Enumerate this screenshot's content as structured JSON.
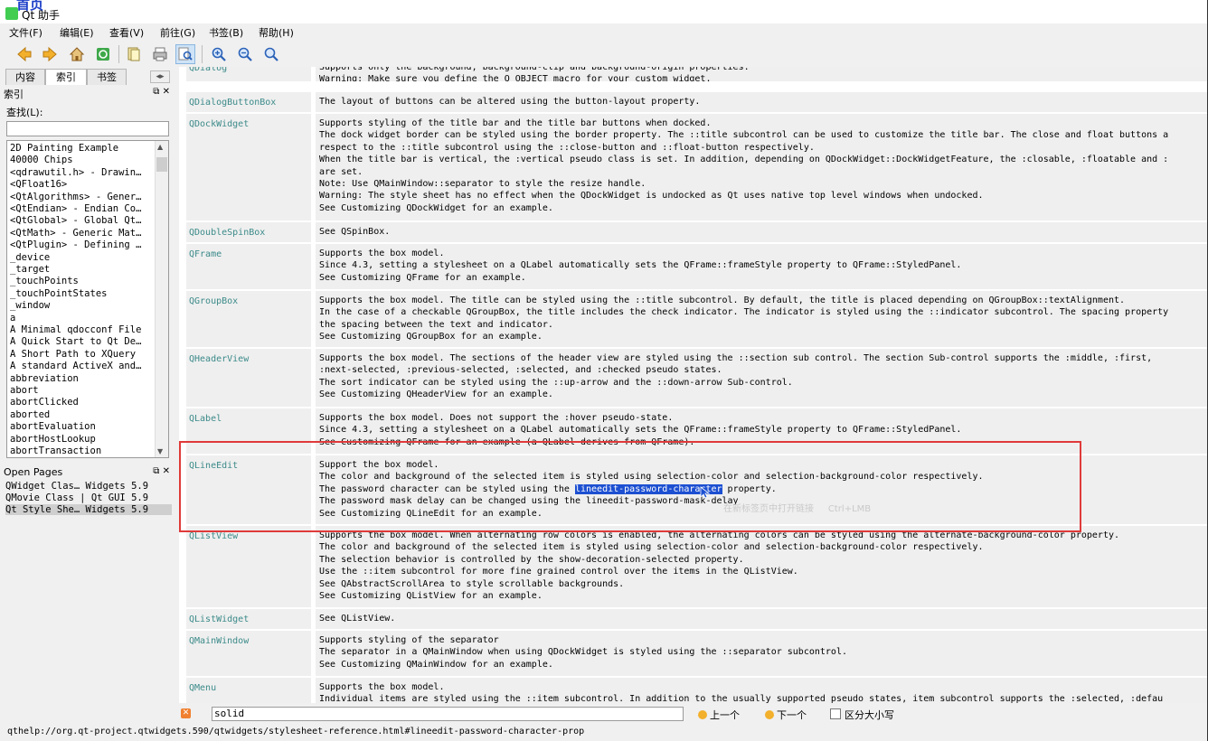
{
  "window": {
    "title": "Qt 助手",
    "overlay_text": "首页"
  },
  "menu": [
    "文件(F)",
    "编辑(E)",
    "查看(V)",
    "前往(G)",
    "书签(B)",
    "帮助(H)"
  ],
  "toolbar": [
    "back-icon",
    "forward-icon",
    "home-icon",
    "sync-icon",
    "copy-icon",
    "print-icon",
    "find-icon",
    "zoom-in-icon",
    "zoom-out-icon",
    "zoom-reset-icon"
  ],
  "sidebar": {
    "tabs": [
      "内容",
      "索引",
      "书签"
    ],
    "index_title": "索引",
    "find_label": "查找(L):",
    "find_value": "",
    "index_items": [
      "2D Painting Example",
      "40000 Chips",
      "<qdrawutil.h> - Drawin…",
      "<QFloat16>",
      "<QtAlgorithms> - Gener…",
      "<QtEndian> - Endian Co…",
      "<QtGlobal> - Global Qt…",
      "<QtMath> - Generic Mat…",
      "<QtPlugin> - Defining …",
      "_device",
      "_target",
      "_touchPoints",
      "_touchPointStates",
      "_window",
      "a",
      "A Minimal qdocconf File",
      "A Quick Start to Qt De…",
      "A Short Path to XQuery",
      "A standard ActiveX and…",
      "abbreviation",
      "abort",
      "abortClicked",
      "aborted",
      "abortEvaluation",
      "abortHostLookup",
      "abortTransaction"
    ],
    "open_pages_title": "Open Pages",
    "open_pages": [
      "QWidget Clas… Widgets 5.9",
      "QMovie Class | Qt GUI 5.9",
      "Qt Style She… Widgets 5.9"
    ]
  },
  "content": {
    "rows": [
      {
        "name": "QDialog",
        "lines": [
          "Supports only the background, background-clip and background-origin properties.",
          "Warning: Make sure you define the Q_OBJECT macro for your custom widget."
        ]
      },
      {
        "name": "QDialogButtonBox",
        "lines": [
          "The layout of buttons can be altered using the button-layout property."
        ]
      },
      {
        "name": "QDockWidget",
        "lines": [
          "Supports styling of the title bar and the title bar buttons when docked.",
          "The dock widget border can be styled using the border property. The ::title subcontrol can be used to customize the title bar. The close and float buttons a",
          "respect to the ::title subcontrol using the ::close-button and ::float-button respectively.",
          "When the title bar is vertical, the :vertical pseudo class is set. In addition, depending on QDockWidget::DockWidgetFeature, the :closable, :floatable and :",
          "are set.",
          "Note: Use QMainWindow::separator to style the resize handle.",
          "Warning: The style sheet has no effect when the QDockWidget is undocked as Qt uses native top level windows when undocked.",
          "See Customizing QDockWidget for an example."
        ]
      },
      {
        "name": "QDoubleSpinBox",
        "lines": [
          "See QSpinBox."
        ]
      },
      {
        "name": "QFrame",
        "lines": [
          "Supports the box model.",
          "Since 4.3, setting a stylesheet on a QLabel automatically sets the QFrame::frameStyle property to QFrame::StyledPanel.",
          "See Customizing QFrame for an example."
        ]
      },
      {
        "name": "QGroupBox",
        "lines": [
          "Supports the box model. The title can be styled using the ::title subcontrol. By default, the title is placed depending on QGroupBox::textAlignment.",
          "In the case of a checkable QGroupBox, the title includes the check indicator. The indicator is styled using the ::indicator subcontrol. The spacing property",
          "the spacing between the text and indicator.",
          "See Customizing QGroupBox for an example."
        ]
      },
      {
        "name": "QHeaderView",
        "lines": [
          "Supports the box model. The sections of the header view are styled using the ::section sub control. The section Sub-control supports the :middle, :first,",
          ":next-selected, :previous-selected, :selected, and :checked pseudo states.",
          "The sort indicator can be styled using the ::up-arrow and the ::down-arrow Sub-control.",
          "See Customizing QHeaderView for an example."
        ]
      },
      {
        "name": "QLabel",
        "lines": [
          "Supports the box model. Does not support the :hover pseudo-state.",
          "Since 4.3, setting a stylesheet on a QLabel automatically sets the QFrame::frameStyle property to QFrame::StyledPanel.",
          "See Customizing QFrame for an example (a QLabel derives from QFrame)."
        ]
      },
      {
        "name": "QLineEdit",
        "lines": [
          "Support the box model.",
          "The color and background of the selected item is styled using selection-color and selection-background-color respectively.",
          "The password character can be styled using the lineedit-password-character property.",
          "The password mask delay can be changed using the lineedit-password-mask-delay",
          "See Customizing QLineEdit for an example."
        ]
      },
      {
        "name": "QListView",
        "lines": [
          "Supports the box model. When alternating row colors is enabled, the alternating colors can be styled using the alternate-background-color property.",
          "The color and background of the selected item is styled using selection-color and selection-background-color respectively.",
          "The selection behavior is controlled by the show-decoration-selected property.",
          "Use the ::item subcontrol for more fine grained control over the items in the QListView.",
          "See QAbstractScrollArea to style scrollable backgrounds.",
          "See Customizing QListView for an example."
        ]
      },
      {
        "name": "QListWidget",
        "lines": [
          "See QListView."
        ]
      },
      {
        "name": "QMainWindow",
        "lines": [
          "Supports styling of the separator",
          "The separator in a QMainWindow when using QDockWidget is styled using the ::separator subcontrol.",
          "See Customizing QMainWindow for an example."
        ]
      },
      {
        "name": "QMenu",
        "lines": [
          "Supports the box model.",
          "Individual items are styled using the ::item subcontrol. In addition to the usually supported pseudo states, item subcontrol supports the :selected, :defau"
        ]
      }
    ],
    "highlight": "lineedit-password-character",
    "context_ghost": [
      "在新标签页中打开链接",
      "Ctrl+LMB"
    ]
  },
  "findbar": {
    "value": "solid",
    "prev": "上一个",
    "next": "下一个",
    "case": "区分大小写"
  },
  "status": "qthelp://org.qt-project.qtwidgets.590/qtwidgets/stylesheet-reference.html#lineedit-password-character-prop",
  "colors": {
    "link": "#3b8a89",
    "highlight": "#1c4fd1",
    "annotation": "#e03a3a"
  }
}
